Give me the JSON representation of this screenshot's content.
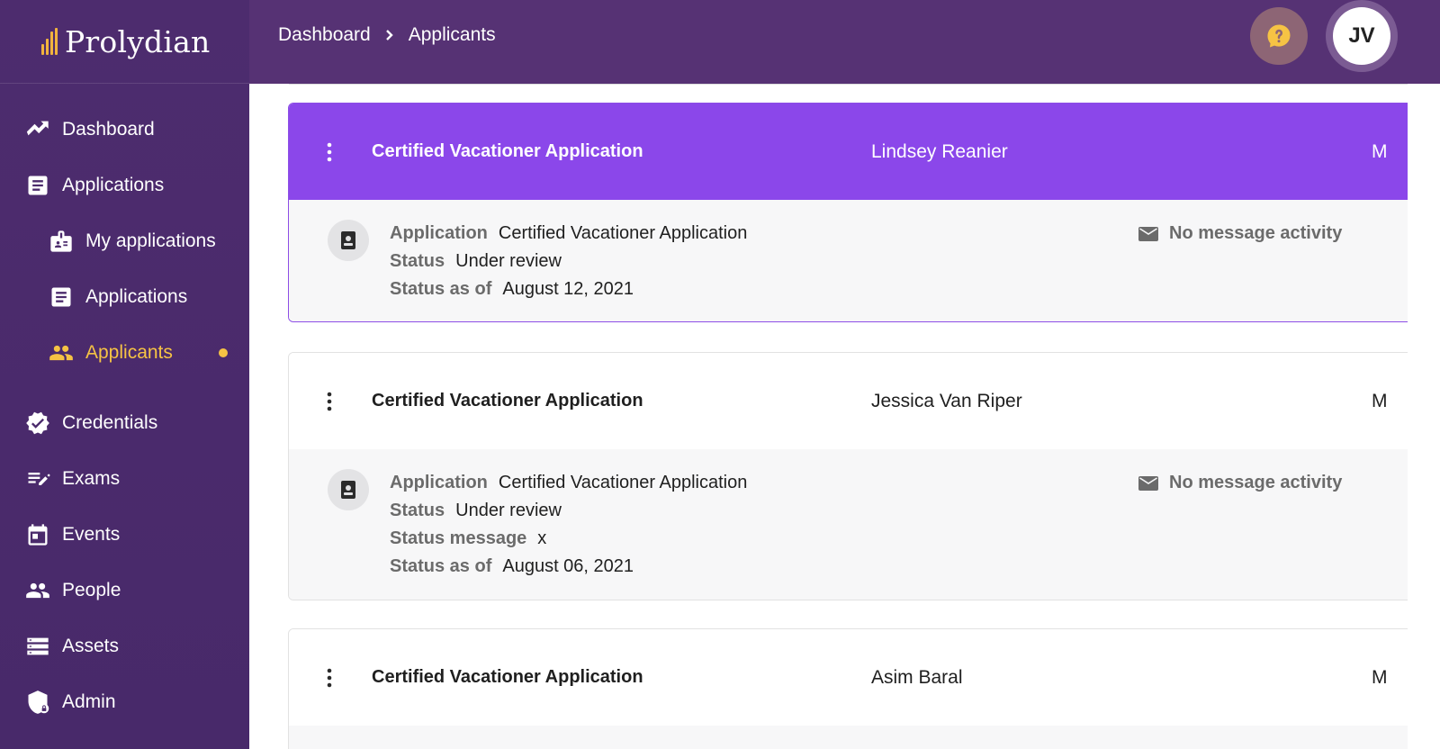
{
  "app": {
    "name": "Prolydian"
  },
  "breadcrumb": {
    "items": [
      "Dashboard",
      "Applicants"
    ]
  },
  "user": {
    "initials": "JV"
  },
  "sidebar": {
    "items": [
      {
        "label": "Dashboard",
        "icon": "trending-up-icon"
      },
      {
        "label": "Applications",
        "icon": "document-icon"
      },
      {
        "label": "My applications",
        "icon": "id-badge-icon"
      },
      {
        "label": "Applications",
        "icon": "document-icon"
      },
      {
        "label": "Applicants",
        "icon": "people-icon",
        "active": true
      },
      {
        "label": "Credentials",
        "icon": "verified-badge-icon"
      },
      {
        "label": "Exams",
        "icon": "edit-list-icon"
      },
      {
        "label": "Events",
        "icon": "calendar-icon"
      },
      {
        "label": "People",
        "icon": "people-icon"
      },
      {
        "label": "Assets",
        "icon": "list-icon"
      },
      {
        "label": "Admin",
        "icon": "shield-lock-icon"
      }
    ]
  },
  "colors": {
    "sidebar_bg": "#4a2a6b",
    "header_bg": "#563274",
    "selected_card": "#8b47ea",
    "active_nav": "#f6c344",
    "help_button": "#8d6575"
  },
  "cards": [
    {
      "title": "Certified Vacationer Application",
      "name": "Lindsey Reanier",
      "extra": "M",
      "selected": true,
      "details": [
        {
          "label": "Application",
          "value": "Certified Vacationer Application"
        },
        {
          "label": "Status",
          "value": "Under review"
        },
        {
          "label": "Status as of",
          "value": "August 12, 2021"
        }
      ],
      "message": "No message activity"
    },
    {
      "title": "Certified Vacationer Application",
      "name": "Jessica Van Riper",
      "extra": "M",
      "selected": false,
      "details": [
        {
          "label": "Application",
          "value": "Certified Vacationer Application"
        },
        {
          "label": "Status",
          "value": "Under review"
        },
        {
          "label": "Status message",
          "value": "x"
        },
        {
          "label": "Status as of",
          "value": "August 06, 2021"
        }
      ],
      "message": "No message activity"
    },
    {
      "title": "Certified Vacationer Application",
      "name": "Asim Baral",
      "extra": "M",
      "selected": false
    }
  ]
}
